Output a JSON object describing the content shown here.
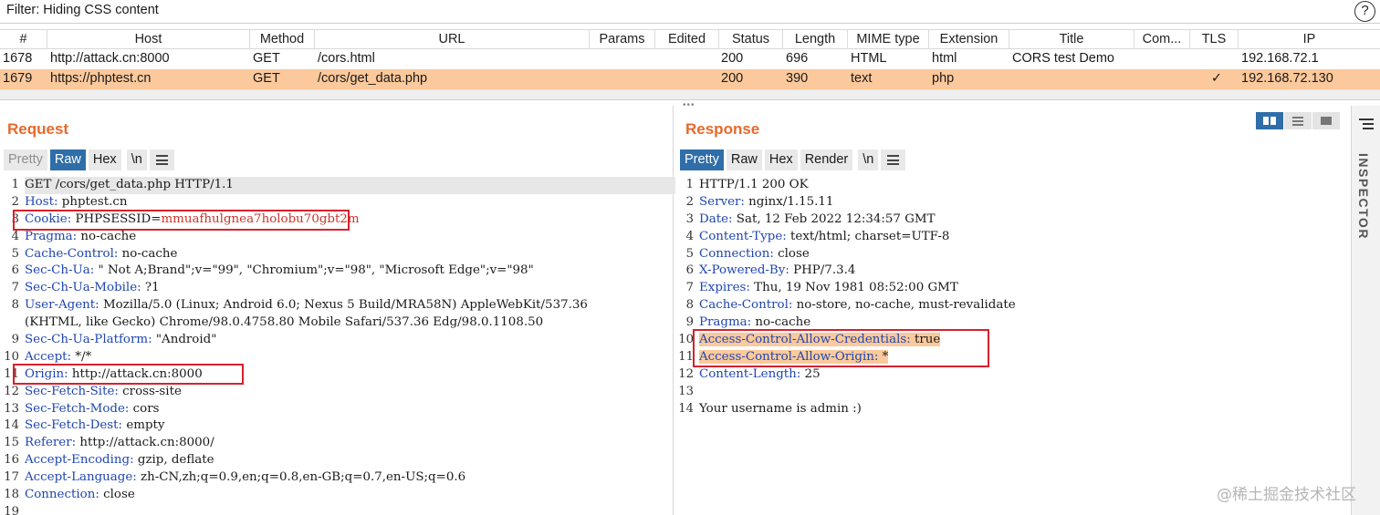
{
  "filter": {
    "text": "Filter: Hiding CSS content",
    "help": "?"
  },
  "table": {
    "headers": [
      "#",
      "Host",
      "Method",
      "URL",
      "Params",
      "Edited",
      "Status",
      "Length",
      "MIME type",
      "Extension",
      "Title",
      "Com...",
      "TLS",
      "IP"
    ],
    "rows": [
      {
        "num": "1678",
        "host": "http://attack.cn:8000",
        "method": "GET",
        "url": "/cors.html",
        "params": "",
        "edited": "",
        "status": "200",
        "length": "696",
        "mime": "HTML",
        "ext": "html",
        "title": "CORS test Demo",
        "comment": "",
        "tls": "",
        "ip": "192.168.72.1"
      },
      {
        "num": "1679",
        "host": "https://phptest.cn",
        "method": "GET",
        "url": "/cors/get_data.php",
        "params": "",
        "edited": "",
        "status": "200",
        "length": "390",
        "mime": "text",
        "ext": "php",
        "title": "",
        "comment": "",
        "tls": "✓",
        "ip": "192.168.72.130"
      }
    ]
  },
  "request": {
    "title": "Request",
    "tabs": [
      "Pretty",
      "Raw",
      "Hex",
      "\\n"
    ],
    "lines": [
      {
        "n": "1",
        "name": "",
        "value": "GET /cors/get_data.php HTTP/1.1"
      },
      {
        "n": "2",
        "name": "Host",
        "value": "phptest.cn"
      },
      {
        "n": "3",
        "name": "Cookie",
        "value": "PHPSESSID=",
        "value2": "mmuafhulgnea7holobu70gbt2m"
      },
      {
        "n": "4",
        "name": "Pragma",
        "value": "no-cache"
      },
      {
        "n": "5",
        "name": "Cache-Control",
        "value": "no-cache"
      },
      {
        "n": "6",
        "name": "Sec-Ch-Ua",
        "value": "\" Not A;Brand\";v=\"99\", \"Chromium\";v=\"98\", \"Microsoft Edge\";v=\"98\""
      },
      {
        "n": "7",
        "name": "Sec-Ch-Ua-Mobile",
        "value": "?1"
      },
      {
        "n": "8",
        "name": "User-Agent",
        "value": "Mozilla/5.0 (Linux; Android 6.0; Nexus 5 Build/MRA58N) AppleWebKit/537.36"
      },
      {
        "n": "",
        "name": "",
        "value": "(KHTML, like Gecko) Chrome/98.0.4758.80 Mobile Safari/537.36 Edg/98.0.1108.50"
      },
      {
        "n": "9",
        "name": "Sec-Ch-Ua-Platform",
        "value": "\"Android\""
      },
      {
        "n": "10",
        "name": "Accept",
        "value": "*/*"
      },
      {
        "n": "11",
        "name": "Origin",
        "value": "http://attack.cn:8000"
      },
      {
        "n": "12",
        "name": "Sec-Fetch-Site",
        "value": "cross-site"
      },
      {
        "n": "13",
        "name": "Sec-Fetch-Mode",
        "value": "cors"
      },
      {
        "n": "14",
        "name": "Sec-Fetch-Dest",
        "value": "empty"
      },
      {
        "n": "15",
        "name": "Referer",
        "value": "http://attack.cn:8000/"
      },
      {
        "n": "16",
        "name": "Accept-Encoding",
        "value": "gzip, deflate"
      },
      {
        "n": "17",
        "name": "Accept-Language",
        "value": "zh-CN,zh;q=0.9,en;q=0.8,en-GB;q=0.7,en-US;q=0.6"
      },
      {
        "n": "18",
        "name": "Connection",
        "value": "close"
      },
      {
        "n": "19",
        "name": "",
        "value": ""
      }
    ]
  },
  "response": {
    "title": "Response",
    "tabs": [
      "Pretty",
      "Raw",
      "Hex",
      "Render",
      "\\n"
    ],
    "lines": [
      {
        "n": "1",
        "name": "",
        "value": "HTTP/1.1 200 OK"
      },
      {
        "n": "2",
        "name": "Server",
        "value": "nginx/1.15.11"
      },
      {
        "n": "3",
        "name": "Date",
        "value": "Sat, 12 Feb 2022 12:34:57 GMT"
      },
      {
        "n": "4",
        "name": "Content-Type",
        "value": "text/html; charset=UTF-8"
      },
      {
        "n": "5",
        "name": "Connection",
        "value": "close"
      },
      {
        "n": "6",
        "name": "X-Powered-By",
        "value": "PHP/7.3.4"
      },
      {
        "n": "7",
        "name": "Expires",
        "value": "Thu, 19 Nov 1981 08:52:00 GMT"
      },
      {
        "n": "8",
        "name": "Cache-Control",
        "value": "no-store, no-cache, must-revalidate"
      },
      {
        "n": "9",
        "name": "Pragma",
        "value": "no-cache"
      },
      {
        "n": "10",
        "name": "Access-Control-Allow-Credentials",
        "value": "true"
      },
      {
        "n": "11",
        "name": "Access-Control-Allow-Origin",
        "value": "*"
      },
      {
        "n": "12",
        "name": "Content-Length",
        "value": "25"
      },
      {
        "n": "13",
        "name": "",
        "value": ""
      },
      {
        "n": "14",
        "name": "",
        "value": "Your username is admin :)"
      }
    ]
  },
  "inspector": {
    "label": "INSPECTOR"
  },
  "watermark": "@稀土掘金技术社区",
  "colors": {
    "accent_orange": "#e8692b",
    "selected_row": "#fbc99b",
    "active_tab": "#2f6ea8",
    "header_name": "#1f46b0",
    "highlight_box": "#d8212c"
  }
}
